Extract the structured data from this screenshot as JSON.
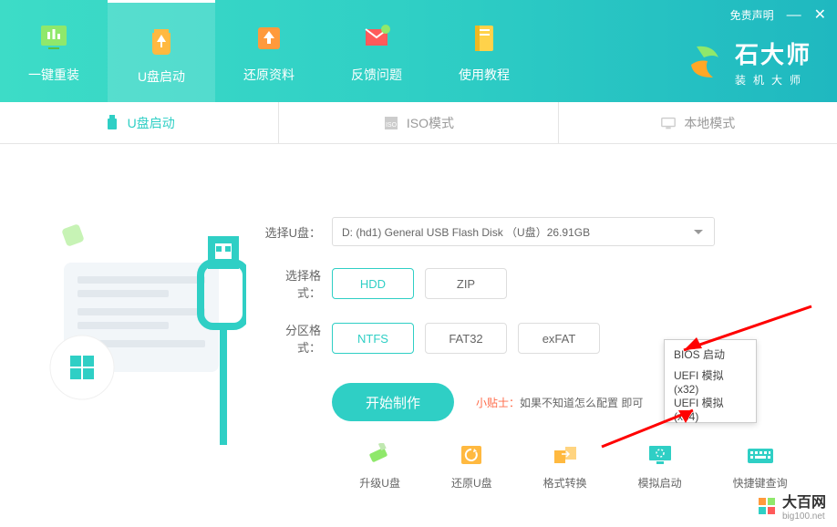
{
  "window": {
    "disclaimer": "免责声明",
    "minimize": "—",
    "close": "✕"
  },
  "nav": {
    "items": [
      {
        "label": "一键重装"
      },
      {
        "label": "U盘启动"
      },
      {
        "label": "还原资料"
      },
      {
        "label": "反馈问题"
      },
      {
        "label": "使用教程"
      }
    ]
  },
  "logo": {
    "title": "石大师",
    "subtitle": "装机大师"
  },
  "tabs": {
    "items": [
      {
        "label": "U盘启动"
      },
      {
        "label": "ISO模式"
      },
      {
        "label": "本地模式"
      }
    ]
  },
  "form": {
    "usb_label": "选择U盘：",
    "usb_value": "D: (hd1) General USB Flash Disk （U盘）26.91GB",
    "format_label": "选择格式：",
    "format_options": [
      "HDD",
      "ZIP"
    ],
    "partition_label": "分区格式：",
    "partition_options": [
      "NTFS",
      "FAT32",
      "exFAT"
    ],
    "start_button": "开始制作",
    "tip_label": "小贴士：",
    "tip_text": "如果不知道怎么配置                即可"
  },
  "tools": {
    "items": [
      {
        "label": "升级U盘"
      },
      {
        "label": "还原U盘"
      },
      {
        "label": "格式转换"
      },
      {
        "label": "模拟启动"
      },
      {
        "label": "快捷键查询"
      }
    ]
  },
  "popup": {
    "items": [
      "BIOS 启动",
      "UEFI 模拟(x32)",
      "UEFI 模拟(x64)"
    ]
  },
  "watermark": {
    "title": "大百网",
    "url": "big100.net"
  }
}
